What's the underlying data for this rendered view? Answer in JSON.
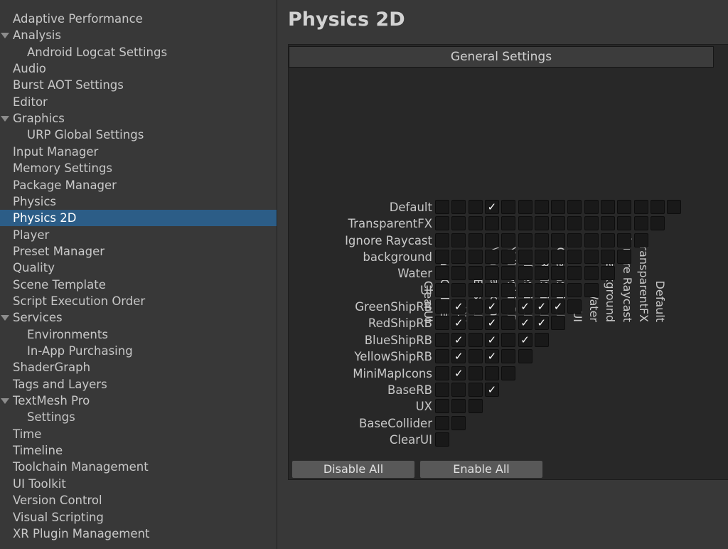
{
  "sidebar": {
    "items": [
      {
        "label": "Adaptive Performance",
        "level": 0
      },
      {
        "label": "Analysis",
        "level": 0,
        "expanded": true
      },
      {
        "label": "Android Logcat Settings",
        "level": 1
      },
      {
        "label": "Audio",
        "level": 0
      },
      {
        "label": "Burst AOT Settings",
        "level": 0
      },
      {
        "label": "Editor",
        "level": 0
      },
      {
        "label": "Graphics",
        "level": 0,
        "expanded": true
      },
      {
        "label": "URP Global Settings",
        "level": 1
      },
      {
        "label": "Input Manager",
        "level": 0
      },
      {
        "label": "Memory Settings",
        "level": 0
      },
      {
        "label": "Package Manager",
        "level": 0
      },
      {
        "label": "Physics",
        "level": 0
      },
      {
        "label": "Physics 2D",
        "level": 0,
        "selected": true
      },
      {
        "label": "Player",
        "level": 0
      },
      {
        "label": "Preset Manager",
        "level": 0
      },
      {
        "label": "Quality",
        "level": 0
      },
      {
        "label": "Scene Template",
        "level": 0
      },
      {
        "label": "Script Execution Order",
        "level": 0
      },
      {
        "label": "Services",
        "level": 0,
        "expanded": true
      },
      {
        "label": "Environments",
        "level": 1
      },
      {
        "label": "In-App Purchasing",
        "level": 1
      },
      {
        "label": "ShaderGraph",
        "level": 0
      },
      {
        "label": "Tags and Layers",
        "level": 0
      },
      {
        "label": "TextMesh Pro",
        "level": 0,
        "expanded": true
      },
      {
        "label": "Settings",
        "level": 1
      },
      {
        "label": "Time",
        "level": 0
      },
      {
        "label": "Timeline",
        "level": 0
      },
      {
        "label": "Toolchain Management",
        "level": 0
      },
      {
        "label": "UI Toolkit",
        "level": 0
      },
      {
        "label": "Version Control",
        "level": 0
      },
      {
        "label": "Visual Scripting",
        "level": 0
      },
      {
        "label": "XR Plugin Management",
        "level": 0
      }
    ]
  },
  "main": {
    "title": "Physics 2D",
    "section_header": "General Settings",
    "matrix": {
      "columns": [
        "ClearUI",
        "BaseCollider",
        "UX",
        "BaseRB",
        "MiniMapIcons",
        "YellowShipRB",
        "BlueShipRB",
        "RedShipRB",
        "GreenShipRB",
        "UI",
        "Water",
        "background",
        "Ignore Raycast",
        "TransparentFX",
        "Default"
      ],
      "rows": [
        "Default",
        "TransparentFX",
        "Ignore Raycast",
        "background",
        "Water",
        "UI",
        "GreenShipRB",
        "RedShipRB",
        "BlueShipRB",
        "YellowShipRB",
        "MiniMapIcons",
        "BaseRB",
        "UX",
        "BaseCollider",
        "ClearUI"
      ],
      "checked": [
        [
          0,
          3
        ],
        [
          6,
          1
        ],
        [
          6,
          3
        ],
        [
          6,
          5
        ],
        [
          6,
          6
        ],
        [
          6,
          7
        ],
        [
          7,
          1
        ],
        [
          7,
          3
        ],
        [
          7,
          5
        ],
        [
          7,
          6
        ],
        [
          8,
          1
        ],
        [
          8,
          3
        ],
        [
          8,
          5
        ],
        [
          9,
          1
        ],
        [
          9,
          3
        ],
        [
          10,
          1
        ],
        [
          11,
          3
        ]
      ],
      "check_glyph": "✓"
    },
    "buttons": {
      "disable_all": "Disable All",
      "enable_all": "Enable All"
    }
  }
}
